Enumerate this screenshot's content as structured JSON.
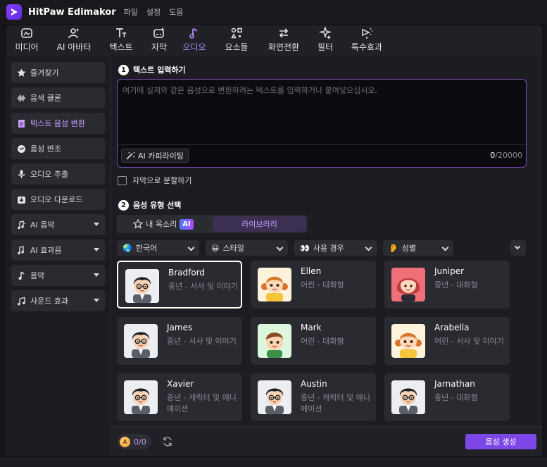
{
  "titlebar": {
    "app_title": "HitPaw Edimakor",
    "menu": [
      "파일",
      "설정",
      "도움"
    ]
  },
  "tabs": [
    {
      "label": "미디어",
      "icon": "media-icon"
    },
    {
      "label": "AI 아바타",
      "icon": "ai-avatar-icon"
    },
    {
      "label": "텍스트",
      "icon": "text-icon"
    },
    {
      "label": "자막",
      "icon": "subtitle-icon"
    },
    {
      "label": "오디오",
      "icon": "music-note-icon",
      "active": true
    },
    {
      "label": "요소들",
      "icon": "elements-icon"
    },
    {
      "label": "화면전환",
      "icon": "transition-icon"
    },
    {
      "label": "필터",
      "icon": "filter-icon"
    },
    {
      "label": "특수효과",
      "icon": "effects-icon"
    }
  ],
  "sidebar": {
    "items": [
      {
        "label": "즐겨찾기",
        "icon": "star-icon"
      },
      {
        "label": "음색 클론",
        "icon": "waveform-icon"
      },
      {
        "label": "텍스트 음성 변환",
        "icon": "text-to-speech-icon",
        "active": true
      },
      {
        "label": "음성 변조",
        "icon": "voice-changer-icon"
      },
      {
        "label": "오디오 추출",
        "icon": "microphone-icon"
      },
      {
        "label": "오디오 다운로드",
        "icon": "download-icon"
      },
      {
        "label": "AI 음악",
        "icon": "ai-music-icon",
        "dropdown": true
      },
      {
        "label": "AI 효과음",
        "icon": "ai-sfx-icon",
        "dropdown": true
      },
      {
        "label": "음악",
        "icon": "music-icon",
        "dropdown": true
      },
      {
        "label": "사운드 효과",
        "icon": "sound-effect-icon",
        "dropdown": true
      }
    ]
  },
  "main": {
    "step1": {
      "num": "1",
      "label": "텍스트 입력하기"
    },
    "textarea": {
      "value": "",
      "placeholder": "여기에 실제와 같은 음성으로 변환하려는 텍스트를 입력하거나 붙여넣으십시오."
    },
    "ai_copy_label": "AI 카피라이팅",
    "counter": {
      "current": "0",
      "max": "/20000"
    },
    "split_checkbox_label": "자막으로 분할하기",
    "step2": {
      "num": "2",
      "label": "음성 유형 선택"
    },
    "segment": {
      "my_voice": "내 목소리",
      "ai_badge": "AI",
      "library": "라이브러리",
      "active": "library"
    },
    "filters": [
      {
        "icon": "🌏",
        "label": "한국어"
      },
      {
        "icon": "😀",
        "label": "스타일"
      },
      {
        "icon": "👀",
        "label": "사용 경우"
      },
      {
        "icon": "👂",
        "label": "성별"
      }
    ],
    "voices": [
      {
        "name": "Bradford",
        "desc": "중년 - 서사 및 이야기",
        "avatar": "man-glasses",
        "selected": true
      },
      {
        "name": "Ellen",
        "desc": "어린 - 대화형",
        "avatar": "girl-braids"
      },
      {
        "name": "Juniper",
        "desc": "중년 - 대화형",
        "avatar": "woman-red"
      },
      {
        "name": "James",
        "desc": "중년 - 서사 및 이야기",
        "avatar": "man-glasses"
      },
      {
        "name": "Mark",
        "desc": "어린 - 대화형",
        "avatar": "boy"
      },
      {
        "name": "Arabella",
        "desc": "어린 - 서사 및 이야기",
        "avatar": "girl-braids"
      },
      {
        "name": "Xavier",
        "desc": "중년 - 캐릭터 및 애니메이션",
        "avatar": "man-glasses"
      },
      {
        "name": "Austin",
        "desc": "중년 - 캐릭터 및 애니메이션",
        "avatar": "man-glasses"
      },
      {
        "name": "Jarnathan",
        "desc": "중년 - 대화형",
        "avatar": "man-glasses"
      }
    ],
    "credits": "0/0",
    "generate_label": "음성 생성"
  },
  "colors": {
    "accent": "#7d46e6",
    "accent_text": "#b98bff",
    "panel": "#1c1c22",
    "card": "#2a2a31"
  }
}
